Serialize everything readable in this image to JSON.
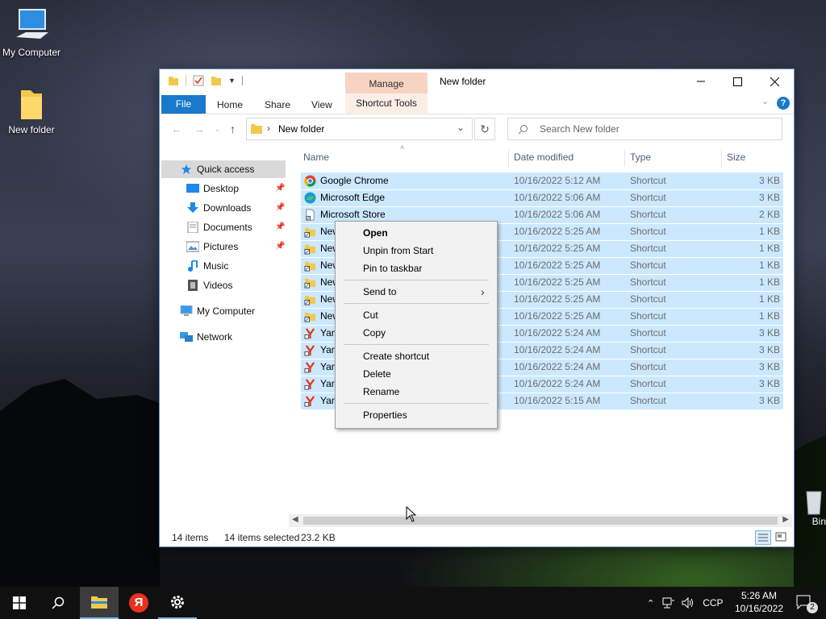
{
  "desktop": {
    "icons": [
      {
        "label": "My Computer"
      },
      {
        "label": "New folder"
      },
      {
        "label": "Bin"
      }
    ]
  },
  "window": {
    "title": "New folder",
    "contextual_tab_group": "Manage",
    "ribbon_tabs": [
      "File",
      "Home",
      "Share",
      "View",
      "Shortcut Tools"
    ],
    "address": {
      "path": "New folder"
    },
    "search": {
      "placeholder": "Search New folder"
    },
    "nav_pane": [
      {
        "label": "Quick access"
      },
      {
        "label": "Desktop"
      },
      {
        "label": "Downloads"
      },
      {
        "label": "Documents"
      },
      {
        "label": "Pictures"
      },
      {
        "label": "Music"
      },
      {
        "label": "Videos"
      },
      {
        "label": "My Computer"
      },
      {
        "label": "Network"
      }
    ],
    "columns": [
      "Name",
      "Date modified",
      "Type",
      "Size"
    ],
    "files": [
      {
        "name": "Google Chrome",
        "date": "10/16/2022 5:12 AM",
        "type": "Shortcut",
        "size": "3 KB",
        "icon": "chrome-icon"
      },
      {
        "name": "Microsoft Edge",
        "date": "10/16/2022 5:06 AM",
        "type": "Shortcut",
        "size": "3 KB",
        "icon": "edge-icon"
      },
      {
        "name": "Microsoft Store",
        "date": "10/16/2022 5:06 AM",
        "type": "Shortcut",
        "size": "2 KB",
        "icon": "file-shortcut-icon"
      },
      {
        "name": "New",
        "date": "10/16/2022 5:25 AM",
        "type": "Shortcut",
        "size": "1 KB",
        "icon": "folder-shortcut-icon"
      },
      {
        "name": "New",
        "date": "10/16/2022 5:25 AM",
        "type": "Shortcut",
        "size": "1 KB",
        "icon": "folder-shortcut-icon"
      },
      {
        "name": "New",
        "date": "10/16/2022 5:25 AM",
        "type": "Shortcut",
        "size": "1 KB",
        "icon": "folder-shortcut-icon"
      },
      {
        "name": "New",
        "date": "10/16/2022 5:25 AM",
        "type": "Shortcut",
        "size": "1 KB",
        "icon": "folder-shortcut-icon"
      },
      {
        "name": "New",
        "date": "10/16/2022 5:25 AM",
        "type": "Shortcut",
        "size": "1 KB",
        "icon": "folder-shortcut-icon"
      },
      {
        "name": "New",
        "date": "10/16/2022 5:25 AM",
        "type": "Shortcut",
        "size": "1 KB",
        "icon": "folder-shortcut-icon"
      },
      {
        "name": "Yan",
        "date": "10/16/2022 5:24 AM",
        "type": "Shortcut",
        "size": "3 KB",
        "icon": "yandex-icon"
      },
      {
        "name": "Yan",
        "date": "10/16/2022 5:24 AM",
        "type": "Shortcut",
        "size": "3 KB",
        "icon": "yandex-icon"
      },
      {
        "name": "Yan",
        "date": "10/16/2022 5:24 AM",
        "type": "Shortcut",
        "size": "3 KB",
        "icon": "yandex-icon"
      },
      {
        "name": "Yan",
        "date": "10/16/2022 5:24 AM",
        "type": "Shortcut",
        "size": "3 KB",
        "icon": "yandex-icon"
      },
      {
        "name": "Yan",
        "date": "10/16/2022 5:15 AM",
        "type": "Shortcut",
        "size": "3 KB",
        "icon": "yandex-icon"
      }
    ],
    "status": {
      "items": "14 items",
      "selected": "14 items selected",
      "size": "23.2 KB"
    }
  },
  "context_menu": {
    "items": [
      "Open",
      "Unpin from Start",
      "Pin to taskbar",
      "Send to",
      "Cut",
      "Copy",
      "Create shortcut",
      "Delete",
      "Rename",
      "Properties"
    ]
  },
  "taskbar": {
    "yandex_letter": "Я",
    "language": "CCP",
    "time": "5:26 AM",
    "date": "10/16/2022",
    "notification_count": "2"
  },
  "colors": {
    "accent": "#1979ca",
    "selection": "#cce8ff",
    "manage_tab": "#f7d4c1"
  }
}
